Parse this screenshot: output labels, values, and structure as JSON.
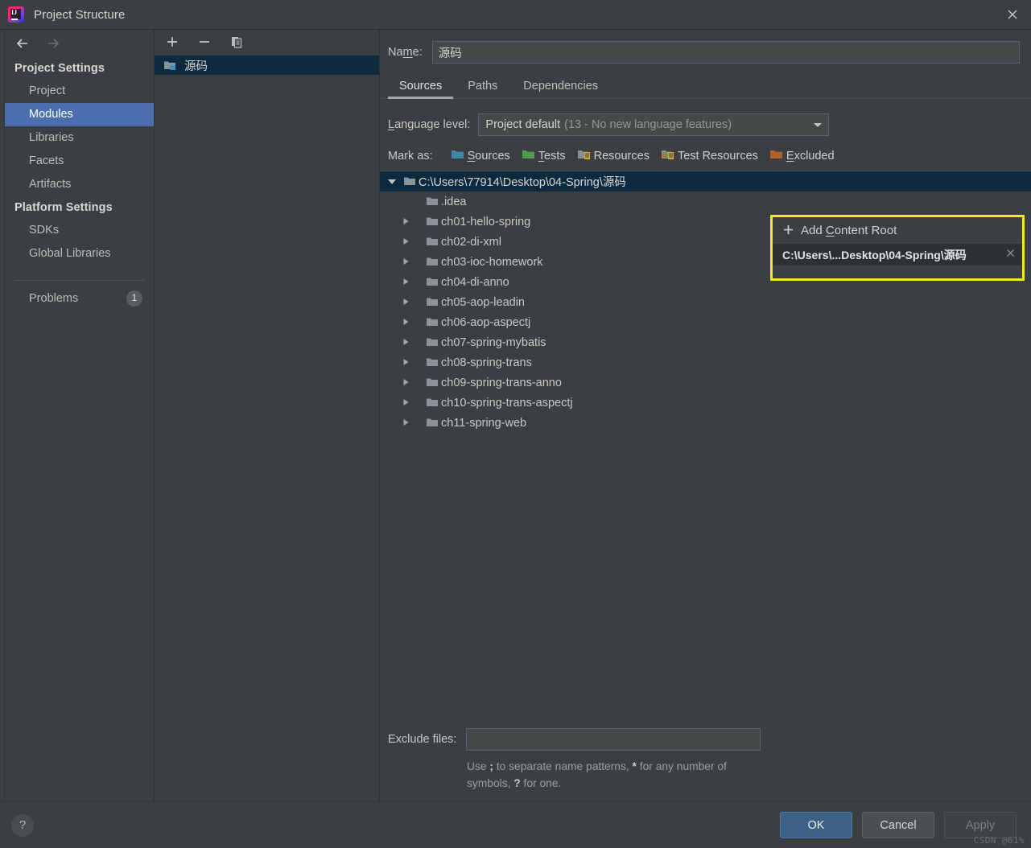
{
  "window": {
    "title": "Project Structure",
    "logo_icon": "intellij-idea-logo",
    "close_icon": "close-icon"
  },
  "sidebar": {
    "back_icon": "arrow-left-icon",
    "forward_icon": "arrow-right-icon",
    "sections": [
      {
        "header": "Project Settings",
        "items": [
          {
            "label": "Project",
            "selected": false
          },
          {
            "label": "Modules",
            "selected": true
          },
          {
            "label": "Libraries",
            "selected": false
          },
          {
            "label": "Facets",
            "selected": false
          },
          {
            "label": "Artifacts",
            "selected": false
          }
        ]
      },
      {
        "header": "Platform Settings",
        "items": [
          {
            "label": "SDKs",
            "selected": false
          },
          {
            "label": "Global Libraries",
            "selected": false
          }
        ]
      }
    ],
    "problems": {
      "label": "Problems",
      "count": "1"
    }
  },
  "modules_panel": {
    "toolbar": {
      "add_icon": "plus-icon",
      "remove_icon": "minus-icon",
      "copy_icon": "copy-icon"
    },
    "items": [
      {
        "label": "源码",
        "icon": "module-folder-icon",
        "selected": true
      }
    ]
  },
  "detail": {
    "name_label": "Name:",
    "name_label_mnemonic": "m",
    "name_value": "源码",
    "tabs": [
      {
        "label": "Sources",
        "active": true
      },
      {
        "label": "Paths",
        "active": false
      },
      {
        "label": "Dependencies",
        "active": false
      }
    ],
    "language_level": {
      "label": "Language level:",
      "label_mnemonic": "L",
      "value": "Project default",
      "value_detail": "(13 - No new language features)",
      "dropdown_icon": "chevron-down-icon"
    },
    "mark_as": {
      "label": "Mark as:",
      "options": [
        {
          "label": "Sources",
          "mnemonic": "S",
          "icon": "sources-folder-icon",
          "color": "#3f8aa8"
        },
        {
          "label": "Tests",
          "mnemonic": "T",
          "icon": "tests-folder-icon",
          "color": "#4f9b4f"
        },
        {
          "label": "Resources",
          "mnemonic": "R",
          "icon": "resources-folder-icon",
          "color": "#8b9095"
        },
        {
          "label": "Test Resources",
          "mnemonic": "",
          "icon": "test-resources-folder-icon",
          "color": "#8b9095"
        },
        {
          "label": "Excluded",
          "mnemonic": "E",
          "icon": "excluded-folder-icon",
          "color": "#b5602b"
        }
      ]
    },
    "tree": {
      "root": {
        "label": "C:\\Users\\77914\\Desktop\\04-Spring\\源码",
        "expanded": true,
        "icon": "folder-icon",
        "selected": true
      },
      "children": [
        {
          "label": ".idea",
          "has_twisty": false,
          "icon": "folder-icon"
        },
        {
          "label": "ch01-hello-spring",
          "has_twisty": true,
          "icon": "folder-icon"
        },
        {
          "label": "ch02-di-xml",
          "has_twisty": true,
          "icon": "folder-icon"
        },
        {
          "label": "ch03-ioc-homework",
          "has_twisty": true,
          "icon": "folder-icon"
        },
        {
          "label": "ch04-di-anno",
          "has_twisty": true,
          "icon": "folder-icon"
        },
        {
          "label": "ch05-aop-leadin",
          "has_twisty": true,
          "icon": "folder-icon"
        },
        {
          "label": "ch06-aop-aspectj",
          "has_twisty": true,
          "icon": "folder-icon"
        },
        {
          "label": "ch07-spring-mybatis",
          "has_twisty": true,
          "icon": "folder-icon"
        },
        {
          "label": "ch08-spring-trans",
          "has_twisty": true,
          "icon": "folder-icon"
        },
        {
          "label": "ch09-spring-trans-anno",
          "has_twisty": true,
          "icon": "folder-icon"
        },
        {
          "label": "ch10-spring-trans-aspectj",
          "has_twisty": true,
          "icon": "folder-icon"
        },
        {
          "label": "ch11-spring-web",
          "has_twisty": true,
          "icon": "folder-icon"
        }
      ]
    },
    "exclude": {
      "label": "Exclude files:",
      "value": "",
      "hint_prefix": "Use ",
      "hint_semi": ";",
      "hint_mid": " to separate name patterns, ",
      "hint_star": "*",
      "hint_mid2": " for any number of symbols, ",
      "hint_q": "?",
      "hint_end": " for one."
    }
  },
  "popup": {
    "add_icon": "plus-icon",
    "add_label": "Add Content Root",
    "add_label_mnemonic": "C",
    "entry": "C:\\Users\\...Desktop\\04-Spring\\源码",
    "remove_icon": "close-icon",
    "highlight_color": "#f3ea1a"
  },
  "footer": {
    "help_icon": "help-icon",
    "help_label": "?",
    "ok_label": "OK",
    "cancel_label": "Cancel",
    "apply_label": "Apply",
    "watermark": "CSDN @61%"
  }
}
